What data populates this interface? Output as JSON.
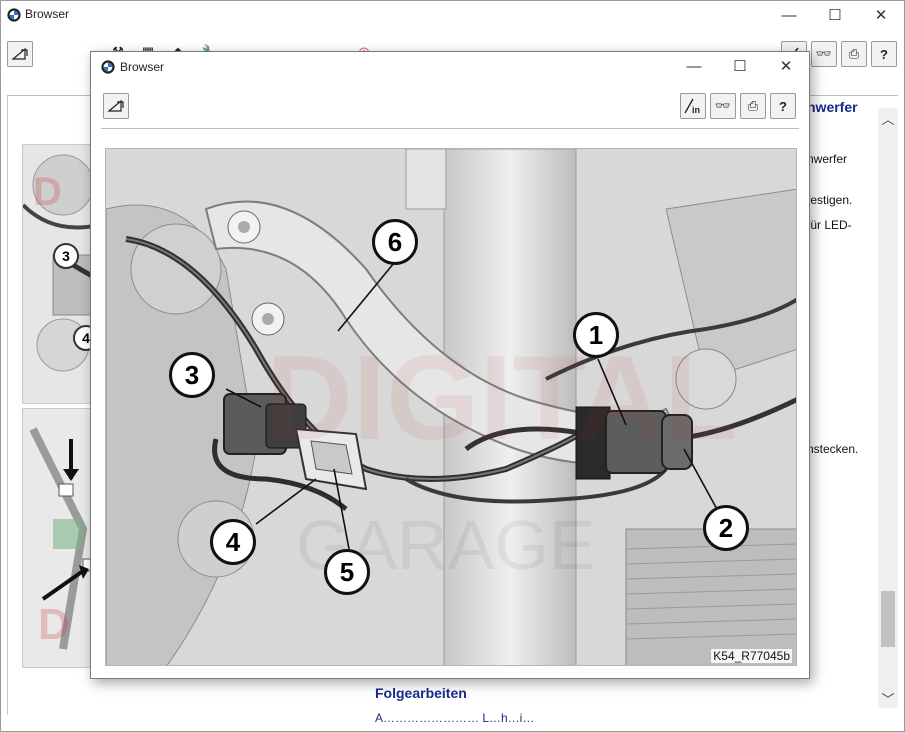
{
  "background_window": {
    "title": "Browser",
    "controls": {
      "minimize": "—",
      "maximize": "☐",
      "close": "✕"
    },
    "right_column": {
      "heading": "nwerfer",
      "lines": [
        "nwerfer",
        "festigen.",
        "für LED-",
        "nstecken."
      ]
    },
    "thumbnail_callouts": [
      "3",
      "4"
    ],
    "follow_up": {
      "heading": "Folgearbeiten",
      "subtext": "A…………………… L…h…i…"
    }
  },
  "popup": {
    "title": "Browser",
    "controls": {
      "minimize": "—",
      "maximize": "☐",
      "close": "✕"
    },
    "figure": {
      "reference": "K54_R77045b",
      "callouts": [
        "1",
        "2",
        "3",
        "4",
        "5",
        "6"
      ]
    }
  }
}
